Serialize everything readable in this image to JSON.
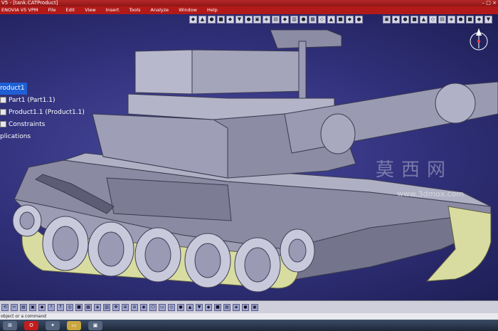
{
  "window": {
    "title": "V5 - [tank.CATProduct]",
    "controls": [
      "–",
      "□",
      "×"
    ]
  },
  "menu": {
    "brand": "ENOVIA V5 VPM",
    "items": [
      "File",
      "Edit",
      "View",
      "Insert",
      "Tools",
      "Analyze",
      "Window",
      "Help"
    ]
  },
  "tree": {
    "root": "roduct1",
    "items": [
      "Part1 (Part1.1)",
      "Product1.1 (Product1.1)",
      "Constraints",
      "plications"
    ]
  },
  "watermark": {
    "text": "莫西网",
    "url": "www.3dmox.com"
  },
  "status": {
    "command_prompt": "object or a command"
  },
  "icons": {
    "compass": "compass-icon",
    "taskbar": [
      "start-icon",
      "opera-icon",
      "catia-icon",
      "folder-icon",
      "window-icon"
    ]
  },
  "colors": {
    "titlebar": "#b21a1a",
    "viewport": "#3a3a8a",
    "tree_selection": "#1f5fd4",
    "model_body": "#8e8ea4",
    "track_pad": "#d8dca0"
  }
}
